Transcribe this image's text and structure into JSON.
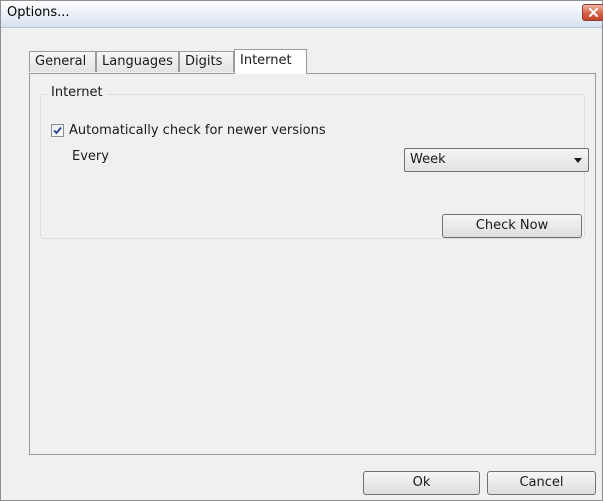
{
  "window": {
    "title": "Options..."
  },
  "tabs": [
    {
      "label": "General"
    },
    {
      "label": "Languages"
    },
    {
      "label": "Digits"
    },
    {
      "label": "Internet",
      "active": true
    }
  ],
  "internet": {
    "group_label": "Internet",
    "auto_check_label": "Automatically check for newer versions",
    "auto_check_checked": true,
    "every_label": "Every",
    "frequency_value": "Week",
    "check_now_label": "Check Now"
  },
  "footer": {
    "ok_label": "Ok",
    "cancel_label": "Cancel"
  },
  "icons": {
    "close": "close-icon",
    "checkmark": "checkmark-icon",
    "dropdown": "chevron-down-icon"
  }
}
